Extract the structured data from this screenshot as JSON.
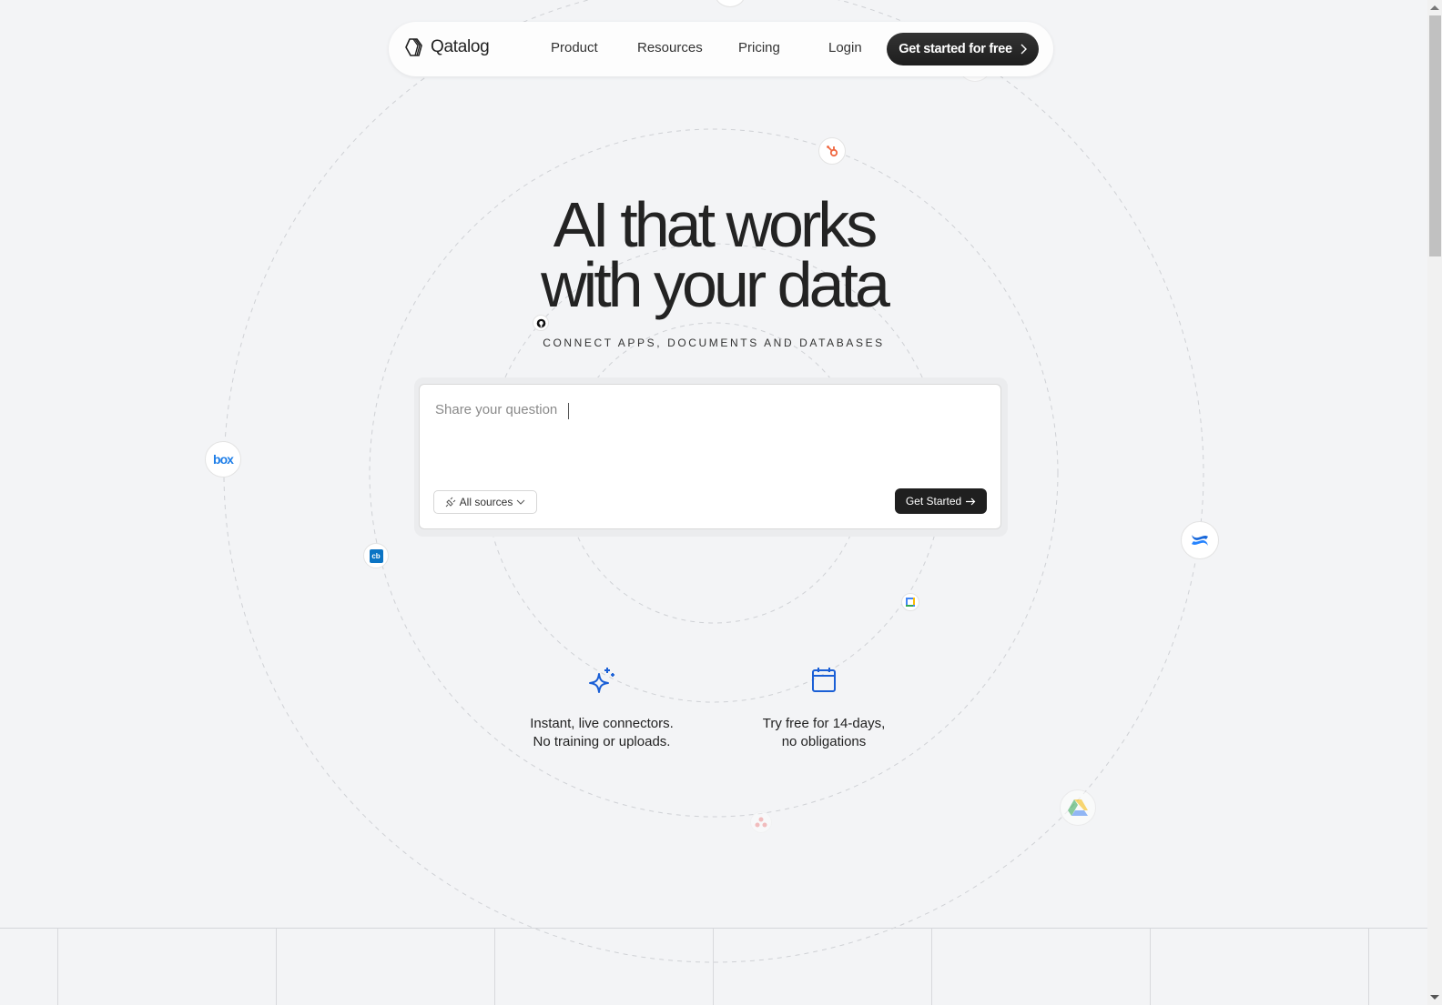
{
  "nav": {
    "brand": "Qatalog",
    "links": [
      "Product",
      "Resources",
      "Pricing",
      "Login"
    ],
    "cta_label": "Get started for free"
  },
  "hero": {
    "title_line1": "AI that works",
    "title_line2": "with your data",
    "subtitle": "CONNECT APPS, DOCUMENTS AND DATABASES"
  },
  "ask": {
    "placeholder": "Share your question",
    "value": "",
    "sources_label": "All sources",
    "submit_label": "Get Started"
  },
  "features": [
    {
      "icon": "sparkles-icon",
      "line1": "Instant, live connectors.",
      "line2": "No training or uploads."
    },
    {
      "icon": "calendar-icon",
      "line1": "Try free for 14-days,",
      "line2": "no obligations"
    }
  ],
  "integrations": [
    "hubspot",
    "github",
    "box",
    "crunchbase",
    "confluence",
    "google-calendar",
    "google-drive",
    "asana"
  ],
  "colors": {
    "accent_blue": "#1a5fd6",
    "dark_button": "#1f1f1f",
    "background": "#f3f4f6"
  }
}
